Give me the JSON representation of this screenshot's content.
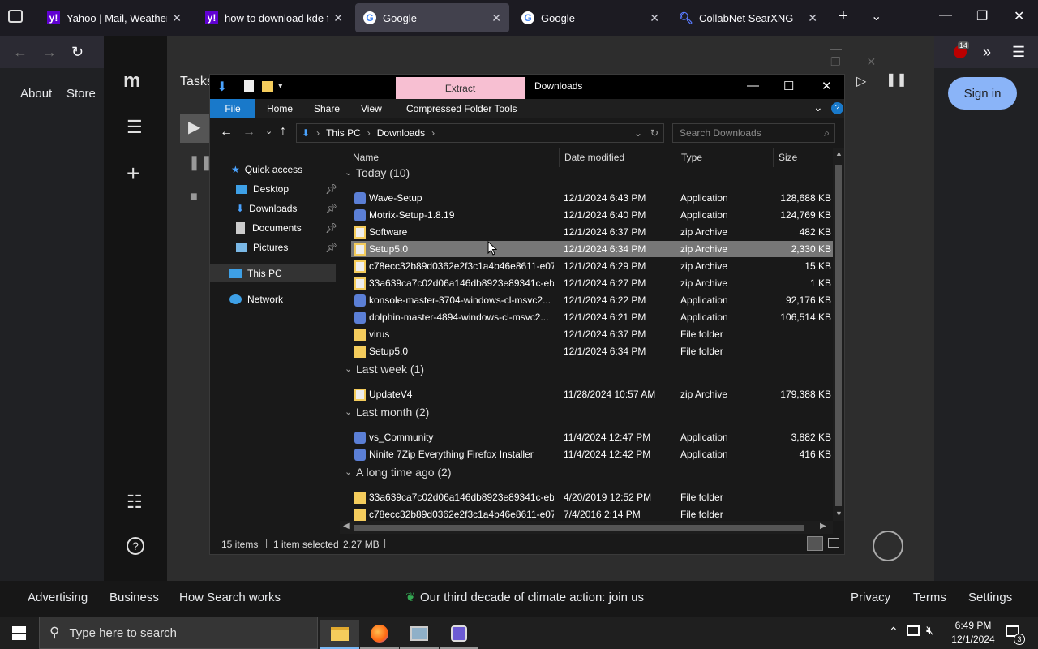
{
  "browser": {
    "tabs": [
      {
        "label": "Yahoo | Mail, Weather, Sea",
        "icon": "yahoo-icon",
        "active": false
      },
      {
        "label": "how to download kde for",
        "icon": "yahoo-icon",
        "active": false
      },
      {
        "label": "Google",
        "icon": "google-icon",
        "active": true
      },
      {
        "label": "Google",
        "icon": "google-icon",
        "active": false
      },
      {
        "label": "CollabNet SearXNG",
        "icon": "search-icon",
        "active": false
      }
    ],
    "extension_badge": "14"
  },
  "google": {
    "header_links": {
      "about": "About",
      "store": "Store"
    },
    "signin_label": "Sign in",
    "footer": {
      "advertising": "Advertising",
      "business": "Business",
      "how_search_works": "How Search works",
      "climate": "Our third decade of climate action: join us",
      "privacy": "Privacy",
      "terms": "Terms",
      "settings": "Settings"
    }
  },
  "motrix": {
    "title": "Tasks"
  },
  "explorer": {
    "extract_tab": "Extract",
    "title": "Downloads",
    "ribbon_tabs": {
      "file": "File",
      "home": "Home",
      "share": "Share",
      "view": "View",
      "compressed": "Compressed Folder Tools"
    },
    "breadcrumb": {
      "this_pc": "This PC",
      "downloads": "Downloads"
    },
    "search_placeholder": "Search Downloads",
    "nav": {
      "quick_access": "Quick access",
      "desktop": "Desktop",
      "downloads": "Downloads",
      "documents": "Documents",
      "pictures": "Pictures",
      "this_pc": "This PC",
      "network": "Network"
    },
    "columns": {
      "name": "Name",
      "date": "Date modified",
      "type": "Type",
      "size": "Size"
    },
    "groups": {
      "today": "Today (10)",
      "last_week": "Last week (1)",
      "last_month": "Last month (2)",
      "long_ago": "A long time ago (2)"
    },
    "rows": [
      {
        "name": "Wave-Setup",
        "date": "12/1/2024 6:43 PM",
        "type": "Application",
        "size": "128,688 KB",
        "icon": "app-icon"
      },
      {
        "name": "Motrix-Setup-1.8.19",
        "date": "12/1/2024 6:40 PM",
        "type": "Application",
        "size": "124,769 KB",
        "icon": "app-icon"
      },
      {
        "name": "Software",
        "date": "12/1/2024 6:37 PM",
        "type": "zip Archive",
        "size": "482 KB",
        "icon": "zip-icon"
      },
      {
        "name": "Setup5.0",
        "date": "12/1/2024 6:34 PM",
        "type": "zip Archive",
        "size": "2,330 KB",
        "icon": "zip-icon"
      },
      {
        "name": "c78ecc32b89d0362e2f3c1a4b46e8611-e07...",
        "date": "12/1/2024 6:29 PM",
        "type": "zip Archive",
        "size": "15 KB",
        "icon": "zip-icon"
      },
      {
        "name": "33a639ca7c02d06a146db8923e89341c-eb...",
        "date": "12/1/2024 6:27 PM",
        "type": "zip Archive",
        "size": "1 KB",
        "icon": "zip-icon"
      },
      {
        "name": "konsole-master-3704-windows-cl-msvc2...",
        "date": "12/1/2024 6:22 PM",
        "type": "Application",
        "size": "92,176 KB",
        "icon": "app-icon"
      },
      {
        "name": "dolphin-master-4894-windows-cl-msvc2...",
        "date": "12/1/2024 6:21 PM",
        "type": "Application",
        "size": "106,514 KB",
        "icon": "app-icon"
      },
      {
        "name": "virus",
        "date": "12/1/2024 6:37 PM",
        "type": "File folder",
        "size": "",
        "icon": "folder-icon"
      },
      {
        "name": "Setup5.0",
        "date": "12/1/2024 6:34 PM",
        "type": "File folder",
        "size": "",
        "icon": "folder-icon"
      },
      {
        "name": "UpdateV4",
        "date": "11/28/2024 10:57 AM",
        "type": "zip Archive",
        "size": "179,388 KB",
        "icon": "zip-icon"
      },
      {
        "name": "vs_Community",
        "date": "11/4/2024 12:47 PM",
        "type": "Application",
        "size": "3,882 KB",
        "icon": "app-icon"
      },
      {
        "name": "Ninite 7Zip Everything Firefox Installer",
        "date": "11/4/2024 12:42 PM",
        "type": "Application",
        "size": "416 KB",
        "icon": "app-icon"
      },
      {
        "name": "33a639ca7c02d06a146db8923e89341c-eb...",
        "date": "4/20/2019 12:52 PM",
        "type": "File folder",
        "size": "",
        "icon": "folder-icon"
      },
      {
        "name": "c78ecc32b89d0362e2f3c1a4b46e8611-e07...",
        "date": "7/4/2016 2:14 PM",
        "type": "File folder",
        "size": "",
        "icon": "folder-icon"
      }
    ],
    "status": {
      "items": "15 items",
      "selected": "1 item selected",
      "size": "2.27 MB"
    }
  },
  "taskbar": {
    "search_placeholder": "Type here to search",
    "time": "6:49 PM",
    "date": "12/1/2024",
    "notification_count": "3"
  }
}
